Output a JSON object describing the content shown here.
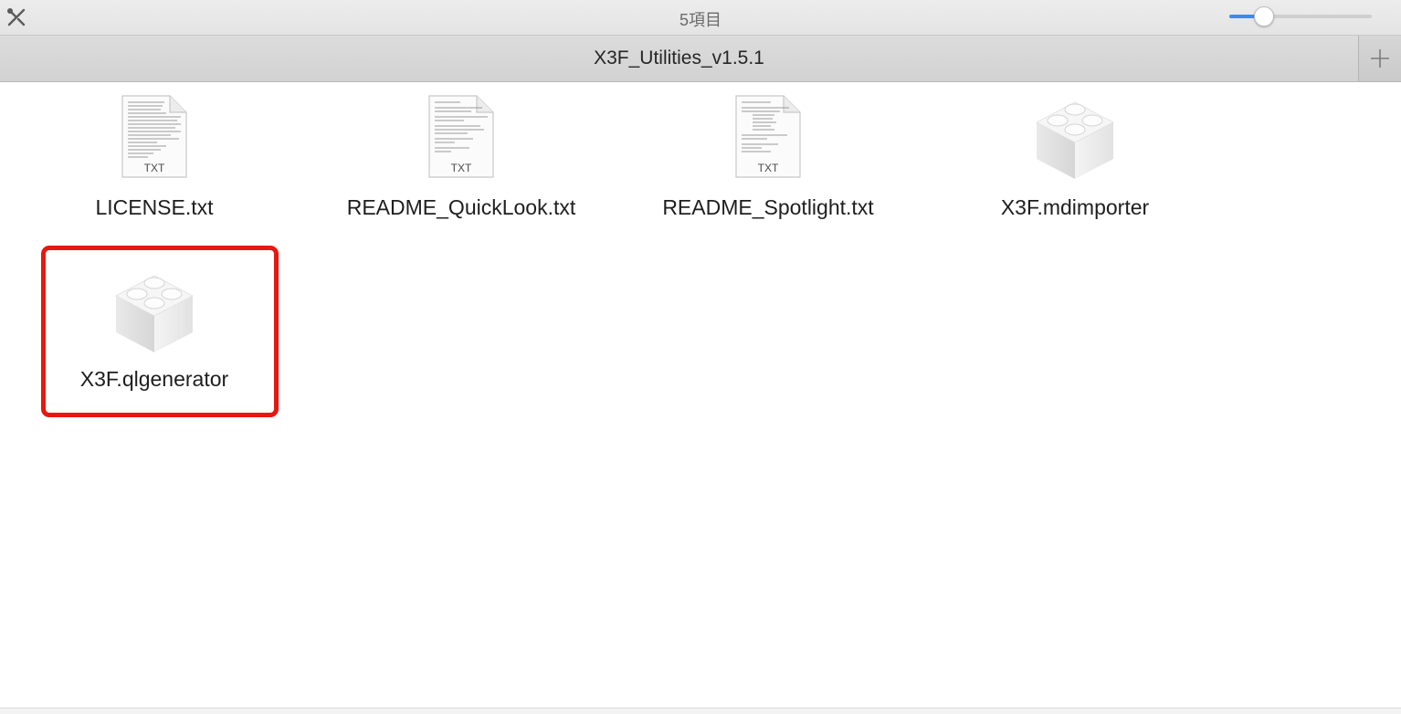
{
  "toolbar": {
    "item_count": "5項目",
    "tools_icon": "tools-icon",
    "zoom_level": 0.2
  },
  "tab": {
    "title": "X3F_Utilities_v1.5.1",
    "new_tab_icon": "plus-icon"
  },
  "files": [
    {
      "name": "LICENSE.txt",
      "kind": "text",
      "ext_label": "TXT"
    },
    {
      "name": "README_QuickLook.txt",
      "kind": "text",
      "ext_label": "TXT"
    },
    {
      "name": "README_Spotlight.txt",
      "kind": "text",
      "ext_label": "TXT"
    },
    {
      "name": "X3F.mdimporter",
      "kind": "plugin",
      "icon": "lego-plugin-icon"
    },
    {
      "name": "X3F.qlgenerator",
      "kind": "plugin",
      "icon": "lego-plugin-icon",
      "highlighted": true
    }
  ],
  "colors": {
    "highlight": "#e8170f",
    "slider_accent": "#3d8af7"
  }
}
